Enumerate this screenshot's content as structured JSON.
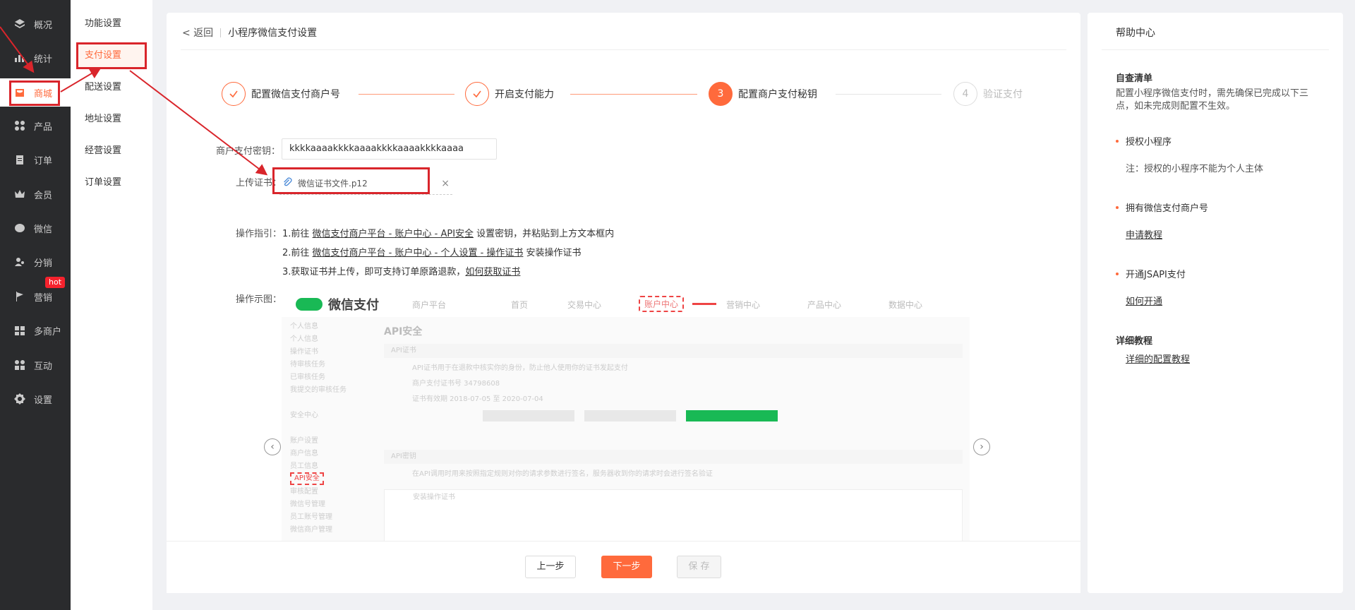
{
  "nav": {
    "items": [
      {
        "label": "概况",
        "icon": "layers-icon"
      },
      {
        "label": "统计",
        "icon": "chart-icon"
      },
      {
        "label": "商城",
        "icon": "shop-icon"
      },
      {
        "label": "产品",
        "icon": "grid-icon"
      },
      {
        "label": "订单",
        "icon": "clipboard-icon"
      },
      {
        "label": "会员",
        "icon": "crown-icon"
      },
      {
        "label": "微信",
        "icon": "wechat-icon"
      },
      {
        "label": "分销",
        "icon": "user-share-icon"
      },
      {
        "label": "营销",
        "icon": "flag-icon"
      },
      {
        "label": "多商户",
        "icon": "store-icon"
      },
      {
        "label": "互动",
        "icon": "interaction-icon"
      },
      {
        "label": "设置",
        "icon": "gear-icon"
      }
    ],
    "hot_badge": "hot"
  },
  "subnav": {
    "items": [
      "功能设置",
      "支付设置",
      "配送设置",
      "地址设置",
      "经营设置",
      "订单设置"
    ]
  },
  "breadcrumb": {
    "back": "< 返回",
    "title": "小程序微信支付设置"
  },
  "steps": [
    {
      "label": "配置微信支付商户号"
    },
    {
      "label": "开启支付能力"
    },
    {
      "number": "3",
      "label": "配置商户支付秘钥"
    },
    {
      "number": "4",
      "label": "验证支付"
    }
  ],
  "form": {
    "key_label": "商户支付密钥：",
    "key_value": "kkkkaaaakkkkaaaakkkkaaaakkkkaaaa",
    "cert_label": "上传证书：",
    "cert_file": "微信证书文件.p12",
    "cert_remove": "×"
  },
  "guide": {
    "label": "操作指引：",
    "line1_pre": "1.前往 ",
    "line1_link": "微信支付商户平台 - 账户中心 - API安全",
    "line1_post": " 设置密钥，并粘贴到上方文本框内",
    "line2_pre": "2.前往 ",
    "line2_link": "微信支付商户平台 - 账户中心 - 个人设置 - 操作证书",
    "line2_post": " 安装操作证书",
    "line3_pre": "3.获取证书并上传，即可支持订单原路退款，",
    "line3_link": "如何获取证书"
  },
  "example": {
    "label": "操作示图：",
    "logo": "微信支付",
    "tabs": [
      "商户平台",
      "首页",
      "交易中心",
      "账户中心",
      "营销中心",
      "产品中心",
      "数据中心"
    ],
    "side_items": [
      "个人信息",
      "个人信息",
      "操作证书",
      "待审核任务",
      "已审核任务",
      "我提交的审核任务",
      "",
      "安全中心",
      "",
      "账户设置",
      "商户信息",
      "员工信息",
      "API安全",
      "审核配置",
      "微信号管理",
      "员工账号管理",
      "微信商户管理"
    ],
    "heading": "API安全",
    "panel1": "API证书",
    "row1": "API证书用于在退款中核实你的身份，防止他人使用你的证书发起支付",
    "row2": "商户支付证书号    34798608",
    "row3": "证书有效期        2018-07-05  至  2020-07-04",
    "panel2": "API密钥",
    "row4": "在API调用时用来按照指定规则对你的请求参数进行签名，服务器收到你的请求时会进行签名验证",
    "row5": "安装操作证书"
  },
  "buttons": {
    "prev": "上一步",
    "next": "下一步",
    "save": "保 存"
  },
  "help": {
    "title": "帮助中心",
    "checklist_title": "自查清单",
    "checklist_desc": "配置小程序微信支付时，需先确保已完成以下三点，如未完成则配置不生效。",
    "item1": "授权小程序",
    "item1_note": "注：授权的小程序不能为个人主体",
    "item2": "拥有微信支付商户号",
    "item2_link": "申请教程",
    "item3": "开通JSAPI支付",
    "item3_link": "如何开通",
    "tutorial_title": "详细教程",
    "tutorial_link": "详细的配置教程"
  }
}
